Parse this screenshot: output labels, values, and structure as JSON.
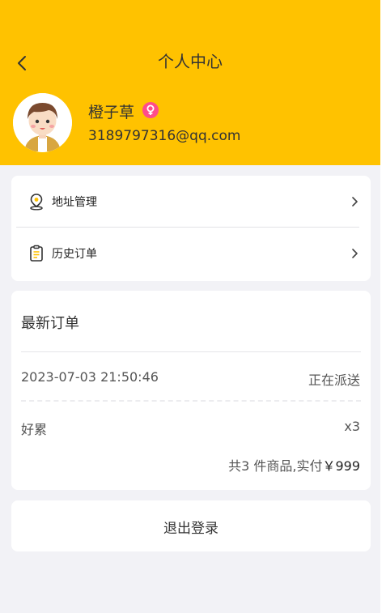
{
  "header": {
    "title": "个人中心",
    "back_icon": "chevron-left-icon"
  },
  "profile": {
    "name": "橙子草",
    "email": "3189797316@qq.com",
    "gender_icon": "female-icon"
  },
  "menu": {
    "items": [
      {
        "label": "地址管理",
        "icon": "location-pin-icon"
      },
      {
        "label": "历史订单",
        "icon": "clipboard-icon"
      }
    ]
  },
  "latest_order": {
    "title": "最新订单",
    "time": "2023-07-03 21:50:46",
    "status": "正在派送",
    "item_name": "好累",
    "item_qty": "x3",
    "total_prefix": "共3 件商品,实付",
    "total_amount": "￥999"
  },
  "logout": {
    "label": "退出登录"
  },
  "colors": {
    "header_bg": "#ffc200",
    "page_bg": "#f2f2f6",
    "gender_badge": "#ff4c8b"
  }
}
